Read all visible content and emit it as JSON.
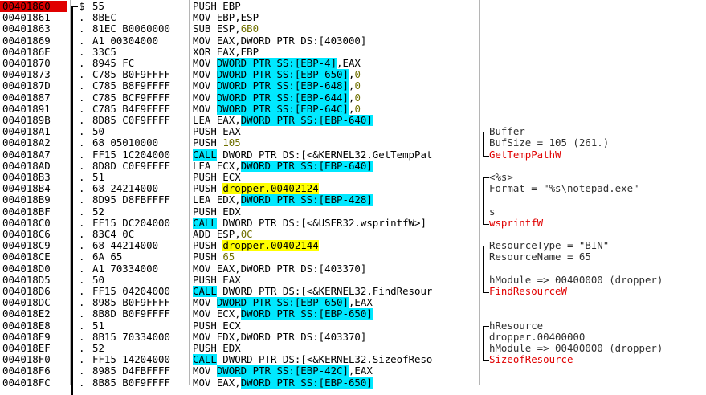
{
  "rows": [
    {
      "addr": "00401860",
      "mark": "r$",
      "hex": "55",
      "cmd": [
        {
          "t": "PUSH EBP"
        }
      ],
      "cmt": "",
      "sel": true
    },
    {
      "addr": "00401861",
      "mark": ".",
      "hex": "8BEC",
      "cmd": [
        {
          "t": "MOV EBP,ESP"
        }
      ],
      "cmt": ""
    },
    {
      "addr": "00401863",
      "mark": ".",
      "hex": "81EC B0060000",
      "cmd": [
        {
          "t": "SUB ESP,"
        },
        {
          "t": "6B0",
          "k": "num"
        }
      ],
      "cmt": ""
    },
    {
      "addr": "00401869",
      "mark": ".",
      "hex": "A1 00304000",
      "cmd": [
        {
          "t": "MOV EAX,DWORD PTR DS:[403000]"
        }
      ],
      "cmt": ""
    },
    {
      "addr": "0040186E",
      "mark": ".",
      "hex": "33C5",
      "cmd": [
        {
          "t": "XOR EAX,EBP"
        }
      ],
      "cmt": ""
    },
    {
      "addr": "00401870",
      "mark": ".",
      "hex": "8945 FC",
      "cmd": [
        {
          "t": "MOV "
        },
        {
          "t": "DWORD PTR SS:[EBP-4]",
          "k": "ref"
        },
        {
          "t": ",EAX"
        }
      ],
      "cmt": ""
    },
    {
      "addr": "00401873",
      "mark": ".",
      "hex": "C785 B0F9FFFF",
      "cmd": [
        {
          "t": "MOV "
        },
        {
          "t": "DWORD PTR SS:[EBP-650]",
          "k": "ref"
        },
        {
          "t": ","
        },
        {
          "t": "0",
          "k": "num"
        }
      ],
      "cmt": ""
    },
    {
      "addr": "0040187D",
      "mark": ".",
      "hex": "C785 B8F9FFFF",
      "cmd": [
        {
          "t": "MOV "
        },
        {
          "t": "DWORD PTR SS:[EBP-648]",
          "k": "ref"
        },
        {
          "t": ","
        },
        {
          "t": "0",
          "k": "num"
        }
      ],
      "cmt": ""
    },
    {
      "addr": "00401887",
      "mark": ".",
      "hex": "C785 BCF9FFFF",
      "cmd": [
        {
          "t": "MOV "
        },
        {
          "t": "DWORD PTR SS:[EBP-644]",
          "k": "ref"
        },
        {
          "t": ","
        },
        {
          "t": "0",
          "k": "num"
        }
      ],
      "cmt": ""
    },
    {
      "addr": "00401891",
      "mark": ".",
      "hex": "C785 B4F9FFFF",
      "cmd": [
        {
          "t": "MOV "
        },
        {
          "t": "DWORD PTR SS:[EBP-64C]",
          "k": "ref"
        },
        {
          "t": ","
        },
        {
          "t": "0",
          "k": "num"
        }
      ],
      "cmt": ""
    },
    {
      "addr": "0040189B",
      "mark": ".",
      "hex": "8D85 C0F9FFFF",
      "cmd": [
        {
          "t": "LEA EAX,"
        },
        {
          "t": "DWORD PTR SS:[EBP-640]",
          "k": "ref"
        }
      ],
      "cmt": ""
    },
    {
      "addr": "004018A1",
      "mark": ".",
      "hex": "50",
      "cmd": [
        {
          "t": "PUSH EAX"
        }
      ],
      "cmt": "Buffer"
    },
    {
      "addr": "004018A2",
      "mark": ".",
      "hex": "68 05010000",
      "cmd": [
        {
          "t": "PUSH "
        },
        {
          "t": "105",
          "k": "num"
        }
      ],
      "cmt": "BufSize = 105 (261.)"
    },
    {
      "addr": "004018A7",
      "mark": ".",
      "hex": "FF15 1C204000",
      "cmd": [
        {
          "t": "CALL",
          "k": "call"
        },
        {
          "t": " DWORD PTR DS:[<&KERNEL32.GetTempPat"
        }
      ],
      "cmt": "GetTempPathW",
      "cmtk": "red"
    },
    {
      "addr": "004018AD",
      "mark": ".",
      "hex": "8D8D C0F9FFFF",
      "cmd": [
        {
          "t": "LEA ECX,"
        },
        {
          "t": "DWORD PTR SS:[EBP-640]",
          "k": "ref"
        }
      ],
      "cmt": ""
    },
    {
      "addr": "004018B3",
      "mark": ".",
      "hex": "51",
      "cmd": [
        {
          "t": "PUSH ECX"
        }
      ],
      "cmt": "<%s>"
    },
    {
      "addr": "004018B4",
      "mark": ".",
      "hex": "68 24214000",
      "cmd": [
        {
          "t": "PUSH "
        },
        {
          "t": "dropper.00402124",
          "k": "str"
        }
      ],
      "cmt": "Format = \"%s\\notepad.exe\""
    },
    {
      "addr": "004018B9",
      "mark": ".",
      "hex": "8D95 D8FBFFFF",
      "cmd": [
        {
          "t": "LEA EDX,"
        },
        {
          "t": "DWORD PTR SS:[EBP-428]",
          "k": "ref"
        }
      ],
      "cmt": ""
    },
    {
      "addr": "004018BF",
      "mark": ".",
      "hex": "52",
      "cmd": [
        {
          "t": "PUSH EDX"
        }
      ],
      "cmt": "s"
    },
    {
      "addr": "004018C0",
      "mark": ".",
      "hex": "FF15 DC204000",
      "cmd": [
        {
          "t": "CALL",
          "k": "call"
        },
        {
          "t": " DWORD PTR DS:[<&USER32.wsprintfW>]"
        }
      ],
      "cmt": "wsprintfW",
      "cmtk": "red"
    },
    {
      "addr": "004018C6",
      "mark": ".",
      "hex": "83C4 0C",
      "cmd": [
        {
          "t": "ADD ESP,"
        },
        {
          "t": "0C",
          "k": "num"
        }
      ],
      "cmt": ""
    },
    {
      "addr": "004018C9",
      "mark": ".",
      "hex": "68 44214000",
      "cmd": [
        {
          "t": "PUSH "
        },
        {
          "t": "dropper.00402144",
          "k": "str"
        }
      ],
      "cmt": "ResourceType = \"BIN\""
    },
    {
      "addr": "004018CE",
      "mark": ".",
      "hex": "6A 65",
      "cmd": [
        {
          "t": "PUSH "
        },
        {
          "t": "65",
          "k": "num"
        }
      ],
      "cmt": "ResourceName = 65"
    },
    {
      "addr": "004018D0",
      "mark": ".",
      "hex": "A1 70334000",
      "cmd": [
        {
          "t": "MOV EAX,DWORD PTR DS:[403370]"
        }
      ],
      "cmt": ""
    },
    {
      "addr": "004018D5",
      "mark": ".",
      "hex": "50",
      "cmd": [
        {
          "t": "PUSH EAX"
        }
      ],
      "cmt": "hModule => 00400000 (dropper)"
    },
    {
      "addr": "004018D6",
      "mark": ".",
      "hex": "FF15 04204000",
      "cmd": [
        {
          "t": "CALL",
          "k": "call"
        },
        {
          "t": " DWORD PTR DS:[<&KERNEL32.FindResour"
        }
      ],
      "cmt": "FindResourceW",
      "cmtk": "red"
    },
    {
      "addr": "004018DC",
      "mark": ".",
      "hex": "8985 B0F9FFFF",
      "cmd": [
        {
          "t": "MOV "
        },
        {
          "t": "DWORD PTR SS:[EBP-650]",
          "k": "ref"
        },
        {
          "t": ",EAX"
        }
      ],
      "cmt": ""
    },
    {
      "addr": "004018E2",
      "mark": ".",
      "hex": "8B8D B0F9FFFF",
      "cmd": [
        {
          "t": "MOV ECX,"
        },
        {
          "t": "DWORD PTR SS:[EBP-650]",
          "k": "ref"
        }
      ],
      "cmt": ""
    },
    {
      "addr": "004018E8",
      "mark": ".",
      "hex": "51",
      "cmd": [
        {
          "t": "PUSH ECX"
        }
      ],
      "cmt": "hResource"
    },
    {
      "addr": "004018E9",
      "mark": ".",
      "hex": "8B15 70334000",
      "cmd": [
        {
          "t": "MOV EDX,DWORD PTR DS:[403370]"
        }
      ],
      "cmt": "dropper.00400000"
    },
    {
      "addr": "004018EF",
      "mark": ".",
      "hex": "52",
      "cmd": [
        {
          "t": "PUSH EDX"
        }
      ],
      "cmt": "hModule => 00400000 (dropper)"
    },
    {
      "addr": "004018F0",
      "mark": ".",
      "hex": "FF15 14204000",
      "cmd": [
        {
          "t": "CALL",
          "k": "call"
        },
        {
          "t": " DWORD PTR DS:[<&KERNEL32.SizeofReso"
        }
      ],
      "cmt": "SizeofResource",
      "cmtk": "red"
    },
    {
      "addr": "004018F6",
      "mark": ".",
      "hex": "8985 D4FBFFFF",
      "cmd": [
        {
          "t": "MOV "
        },
        {
          "t": "DWORD PTR SS:[EBP-42C]",
          "k": "ref"
        },
        {
          "t": ",EAX"
        }
      ],
      "cmt": ""
    },
    {
      "addr": "004018FC",
      "mark": ".",
      "hex": "8B85 B0F9FFFF",
      "cmd": [
        {
          "t": "MOV EAX,"
        },
        {
          "t": "DWORD PTR SS:[EBP-650]",
          "k": "ref"
        }
      ],
      "cmt": ""
    }
  ],
  "colors": {
    "selected_address_bg": "#e00000",
    "memory_ref_bg": "#00e8ff",
    "string_ref_bg": "#ffff00",
    "call_bg": "#00e8ff",
    "api_comment": "#e00000",
    "immediate_value": "#707000"
  }
}
